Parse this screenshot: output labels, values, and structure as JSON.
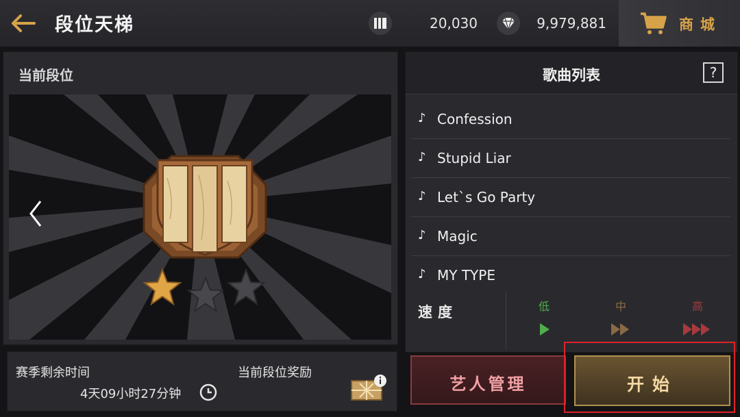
{
  "header": {
    "title": "段位天梯",
    "currencies": [
      {
        "icon": "ticket-card-icon",
        "value": "20,030"
      },
      {
        "icon": "diamond-icon",
        "value": "9,979,881"
      }
    ],
    "shop_label": "商城"
  },
  "rank_panel": {
    "title": "当前段位",
    "stars_total": 3,
    "stars_earned": 1
  },
  "season": {
    "remaining_label": "赛季剩余时间",
    "remaining_time": "4天09小时27分钟",
    "reward_label": "当前段位奖励"
  },
  "songs": {
    "title": "歌曲列表",
    "help_label": "?",
    "items": [
      {
        "name": "Confession"
      },
      {
        "name": "Stupid Liar"
      },
      {
        "name": "Let`s Go Party"
      },
      {
        "name": "Magic"
      },
      {
        "name": "MY TYPE"
      }
    ]
  },
  "speed": {
    "label": "速度",
    "options": [
      {
        "label": "低",
        "selected": true
      },
      {
        "label": "中",
        "selected": false
      },
      {
        "label": "高",
        "selected": false
      }
    ]
  },
  "actions": {
    "artist_label": "艺人管理",
    "start_label": "开始"
  },
  "colors": {
    "accent_gold": "#d7a34a",
    "speed_low": "#4fae4a",
    "speed_mid": "#8a6a44",
    "speed_high": "#a83a3e",
    "highlight_red": "#e0222a"
  }
}
